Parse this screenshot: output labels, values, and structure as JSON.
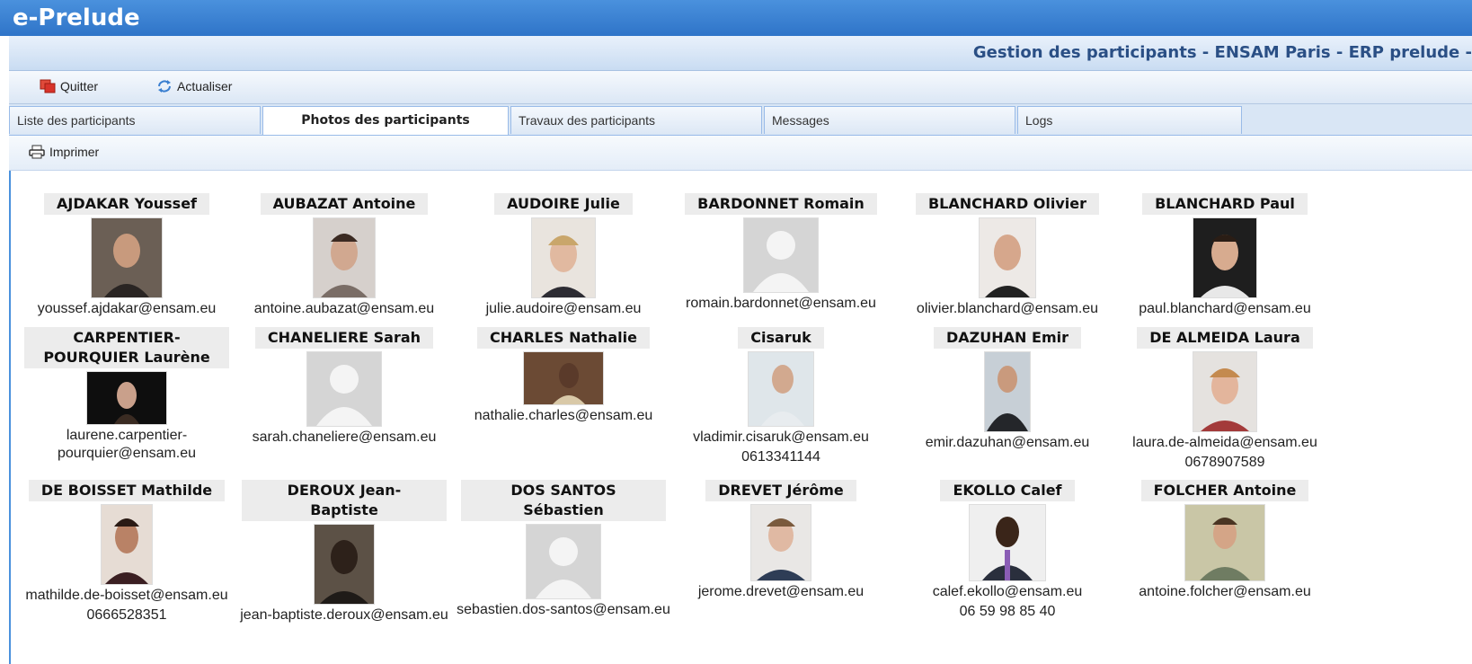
{
  "app_title": "e-Prelude",
  "window_title": "Gestion des participants - ENSAM Paris - ERP prelude -",
  "toolbar": {
    "quit_label": "Quitter",
    "refresh_label": "Actualiser"
  },
  "tabs": [
    {
      "label": "Liste des participants"
    },
    {
      "label": "Photos des participants"
    },
    {
      "label": "Travaux des participants"
    },
    {
      "label": "Messages"
    },
    {
      "label": "Logs"
    }
  ],
  "print_label": "Imprimer",
  "participants": [
    {
      "name": "AJDAKAR Youssef",
      "email": "youssef.ajdakar@ensam.eu",
      "phone": "",
      "has_photo": true
    },
    {
      "name": "AUBAZAT Antoine",
      "email": "antoine.aubazat@ensam.eu",
      "phone": "",
      "has_photo": true
    },
    {
      "name": "AUDOIRE Julie",
      "email": "julie.audoire@ensam.eu",
      "phone": "",
      "has_photo": true
    },
    {
      "name": "BARDONNET Romain",
      "email": "romain.bardonnet@ensam.eu",
      "phone": "",
      "has_photo": false
    },
    {
      "name": "BLANCHARD Olivier",
      "email": "olivier.blanchard@ensam.eu",
      "phone": "",
      "has_photo": true
    },
    {
      "name": "BLANCHARD Paul",
      "email": "paul.blanchard@ensam.eu",
      "phone": "",
      "has_photo": true
    },
    {
      "name": "CARPENTIER-POURQUIER Laurène",
      "email": "laurene.carpentier-pourquier@ensam.eu",
      "phone": "",
      "has_photo": true
    },
    {
      "name": "CHANELIERE Sarah",
      "email": "sarah.chaneliere@ensam.eu",
      "phone": "",
      "has_photo": false
    },
    {
      "name": "CHARLES Nathalie",
      "email": "nathalie.charles@ensam.eu",
      "phone": "",
      "has_photo": true
    },
    {
      "name": "Cisaruk",
      "email": "vladimir.cisaruk@ensam.eu",
      "phone": "0613341144",
      "has_photo": true
    },
    {
      "name": "DAZUHAN Emir",
      "email": "emir.dazuhan@ensam.eu",
      "phone": "",
      "has_photo": true
    },
    {
      "name": "DE ALMEIDA Laura",
      "email": "laura.de-almeida@ensam.eu",
      "phone": "0678907589",
      "has_photo": true
    },
    {
      "name": "DE BOISSET Mathilde",
      "email": "mathilde.de-boisset@ensam.eu",
      "phone": "0666528351",
      "has_photo": true
    },
    {
      "name": "DEROUX Jean-Baptiste",
      "email": "jean-baptiste.deroux@ensam.eu",
      "phone": "",
      "has_photo": true
    },
    {
      "name": "DOS SANTOS Sébastien",
      "email": "sebastien.dos-santos@ensam.eu",
      "phone": "",
      "has_photo": false
    },
    {
      "name": "DREVET Jérôme",
      "email": "jerome.drevet@ensam.eu",
      "phone": "",
      "has_photo": true
    },
    {
      "name": "EKOLLO Calef",
      "email": "calef.ekollo@ensam.eu",
      "phone": "06 59 98 85 40",
      "has_photo": true
    },
    {
      "name": "FOLCHER Antoine",
      "email": "antoine.folcher@ensam.eu",
      "phone": "",
      "has_photo": true
    }
  ],
  "colors": {
    "title_bar": "#2f74c8",
    "header_text": "#2a4f85",
    "tab_border": "#99bbe8"
  }
}
